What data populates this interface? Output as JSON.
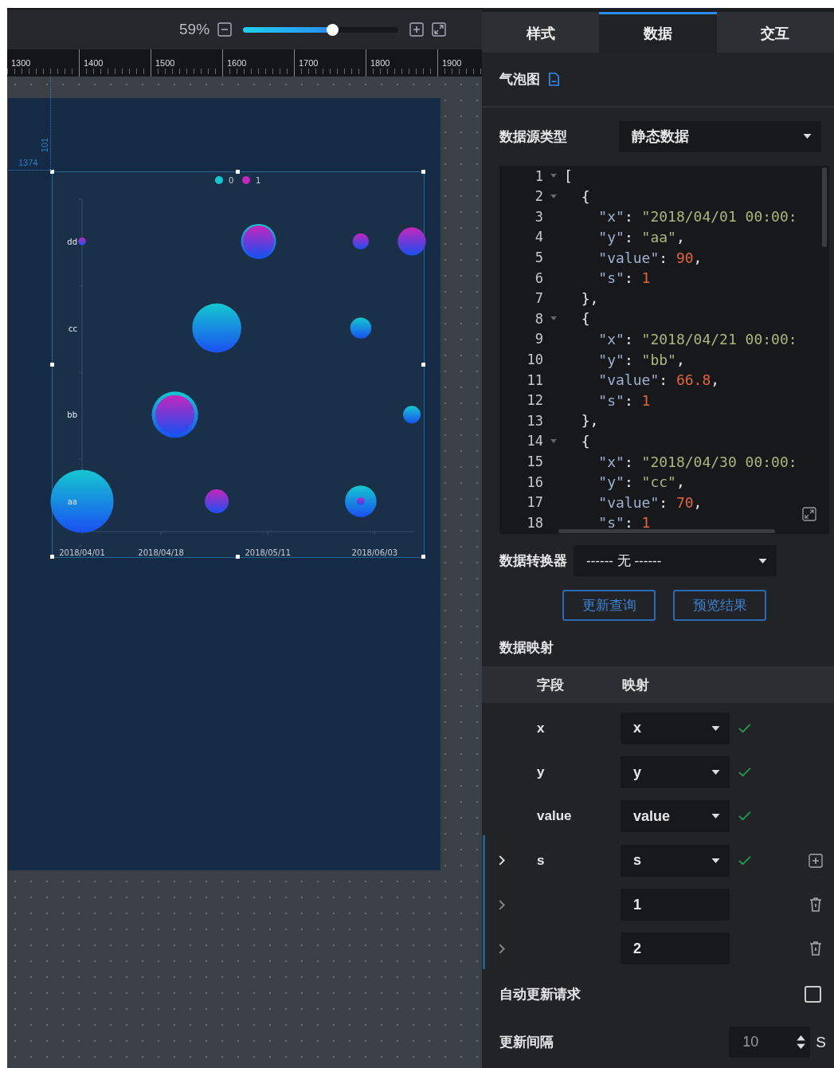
{
  "toolbar": {
    "zoom": "59%",
    "zoom_slider": {
      "level": 0.58
    }
  },
  "ruler": {
    "labels": [
      "1300",
      "1400",
      "1500",
      "1600",
      "1700",
      "1800",
      "1900"
    ]
  },
  "canvas": {
    "guides": {
      "vertical": "101",
      "horizontal": "1374"
    },
    "chart": {
      "legend": [
        {
          "name": "0",
          "color": "#14c8d0"
        },
        {
          "name": "1",
          "color": "#c626bc"
        }
      ],
      "y_labels": [
        "dd",
        "cc",
        "bb",
        "aa"
      ],
      "x_labels": [
        "2018/04/01",
        "2018/04/18",
        "2018/05/11",
        "2018/06/03"
      ]
    }
  },
  "panel": {
    "tabs": [
      {
        "label": "样式",
        "selected": false
      },
      {
        "label": "数据",
        "selected": true
      },
      {
        "label": "交互",
        "selected": false
      }
    ],
    "title": "气泡图",
    "source_type": {
      "label": "数据源类型",
      "value": "静态数据"
    },
    "editor": {
      "lines": [
        {
          "number": "1",
          "text": "[",
          "foldable": true
        },
        {
          "number": "2",
          "text": "  {",
          "foldable": true
        },
        {
          "number": "3",
          "text": "    \"x\": \"2018/04/01 00:00:",
          "foldable": false
        },
        {
          "number": "4",
          "text": "    \"y\": \"aa\",",
          "foldable": false
        },
        {
          "number": "5",
          "text": "    \"value\": 90,",
          "foldable": false
        },
        {
          "number": "6",
          "text": "    \"s\": 1",
          "foldable": false
        },
        {
          "number": "7",
          "text": "  },",
          "foldable": false
        },
        {
          "number": "8",
          "text": "  {",
          "foldable": true
        },
        {
          "number": "9",
          "text": "    \"x\": \"2018/04/21 00:00:",
          "foldable": false
        },
        {
          "number": "10",
          "text": "    \"y\": \"bb\",",
          "foldable": false
        },
        {
          "number": "11",
          "text": "    \"value\": 66.8,",
          "foldable": false
        },
        {
          "number": "12",
          "text": "    \"s\": 1",
          "foldable": false
        },
        {
          "number": "13",
          "text": "  },",
          "foldable": false
        },
        {
          "number": "14",
          "text": "  {",
          "foldable": true
        },
        {
          "number": "15",
          "text": "    \"x\": \"2018/04/30 00:00:",
          "foldable": false
        },
        {
          "number": "16",
          "text": "    \"y\": \"cc\",",
          "foldable": false
        },
        {
          "number": "17",
          "text": "    \"value\": 70,",
          "foldable": false
        },
        {
          "number": "18",
          "text": "    \"s\": 1",
          "foldable": false
        }
      ]
    },
    "converter": {
      "label": "数据转换器",
      "value": "------ 无 ------"
    },
    "buttons": [
      "更新查询",
      "预览结果"
    ],
    "mapping": {
      "title": "数据映射",
      "columns": [
        "字段",
        "映射"
      ],
      "rows": [
        {
          "kind": "select",
          "field": "x",
          "value": "x",
          "valid": true
        },
        {
          "kind": "select",
          "field": "y",
          "value": "y",
          "valid": true
        },
        {
          "kind": "select",
          "field": "value",
          "value": "value",
          "valid": true
        },
        {
          "kind": "select",
          "field": "s",
          "value": "s",
          "valid": true,
          "children": [
            {
              "kind": "input",
              "value": "1"
            },
            {
              "kind": "input",
              "value": "2"
            }
          ]
        }
      ]
    },
    "auto_update": {
      "label": "自动更新请求",
      "checked": false
    },
    "interval": {
      "label": "更新间隔",
      "value": "10",
      "unit": "S"
    }
  }
}
